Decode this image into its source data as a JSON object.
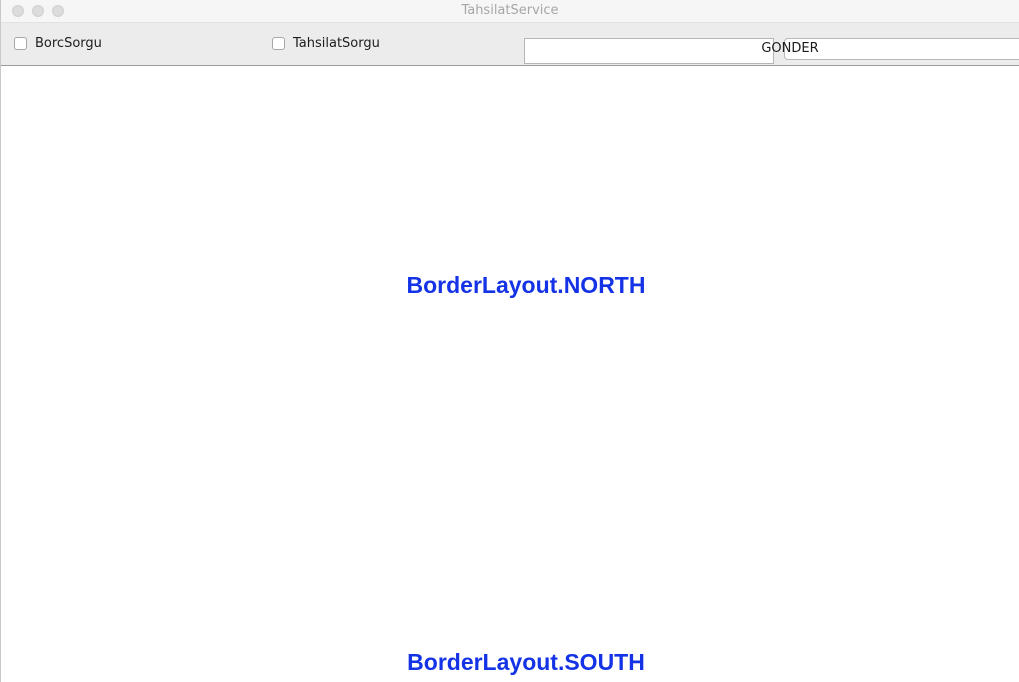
{
  "window": {
    "title": "TahsilatService"
  },
  "toolbar": {
    "borc_label": "BorcSorgu",
    "tahsilat_label": "TahsilatSorgu",
    "input_value": "",
    "send_label": "GONDER"
  },
  "layout_labels": {
    "north": "BorderLayout.NORTH",
    "south": "BorderLayout.SOUTH"
  },
  "colors": {
    "label_blue": "#1533e6"
  }
}
